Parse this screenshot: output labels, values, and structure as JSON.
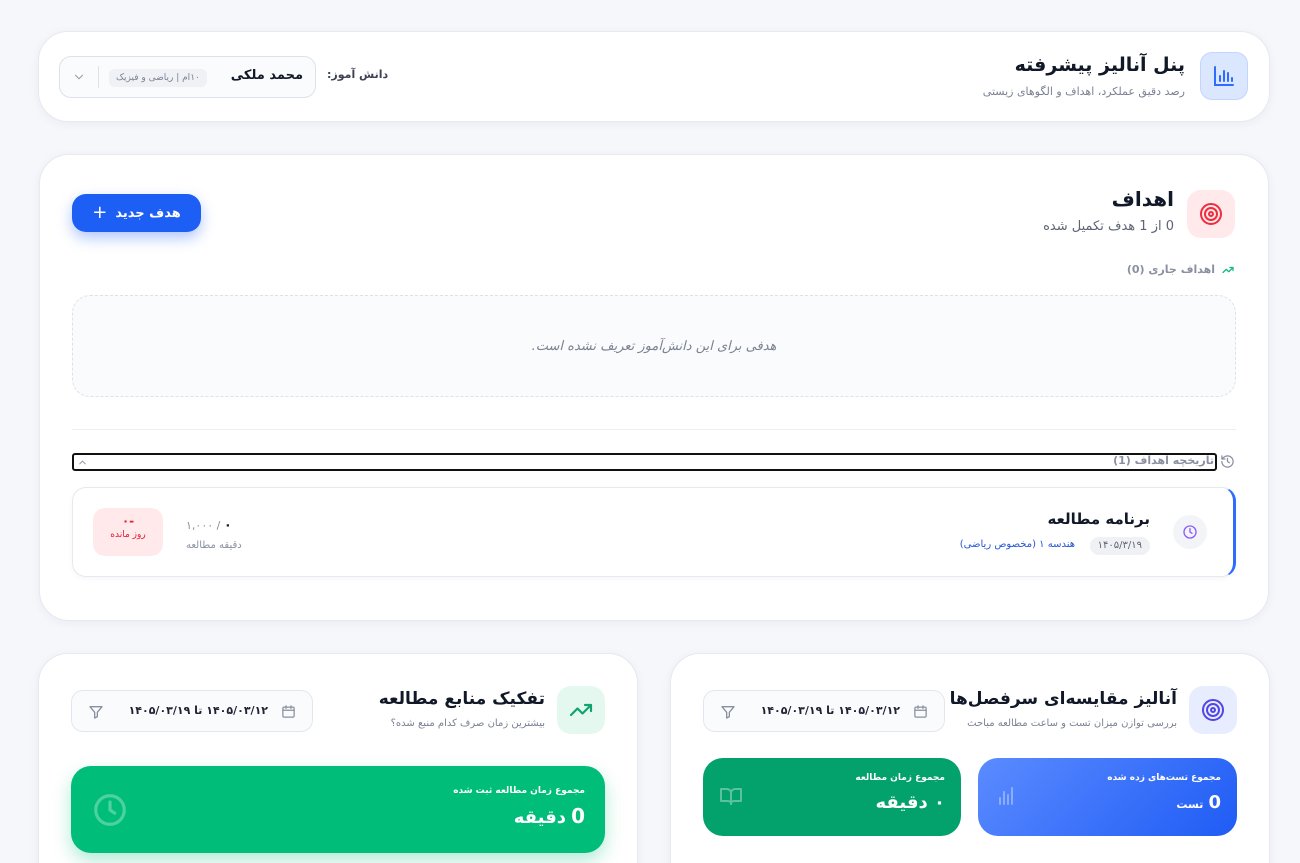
{
  "header": {
    "title": "پنل آنالیز پیشرفته",
    "subtitle": "رصد دقیق عملکرد، اهداف و الگوهای زیستی",
    "student_label": "دانش آموز:",
    "student_name": "محمد ملکی",
    "student_tag": "۱۰ام | ریاضی و فیزیک"
  },
  "goals": {
    "title": "اهداف",
    "summary": "0 از 1 هدف تکمیل شده",
    "new_goal_button": "هدف جدید",
    "active_label": "اهداف جاری (0)",
    "empty_message": "هدفی برای این دانش‌آموز تعریف نشده است.",
    "history_label": "تاریخچه اهداف (1)",
    "history_items": [
      {
        "title": "برنامه مطالعه",
        "date": "۱۴۰۵/۳/۱۹",
        "subject": "هندسه ۱ (مخصوص ریاضی)",
        "progress_done": "۰",
        "progress_target": "/ ۱,۰۰۰",
        "unit": "دقیقه مطالعه",
        "days_left": "-۰",
        "days_left_label": "روز مانده"
      }
    ]
  },
  "compare": {
    "title": "آنالیز مقایسه‌ای سرفصل‌ها",
    "subtitle": "بررسی توازن میزان تست و ساعت مطالعه مباحث",
    "date_range": "۱۴۰۵/۰۳/۱۲ تا ۱۴۰۵/۰۳/۱۹",
    "tests_label": "مجموع تست‌های زده شده",
    "tests_value": "0",
    "tests_unit": "تست",
    "time_label": "مجموع زمان مطالعه",
    "time_value": "۰ دقیقه"
  },
  "sources": {
    "title": "تفکیک منابع مطالعه",
    "subtitle": "بیشترین زمان صرف کدام منبع شده؟",
    "date_range": "۱۴۰۵/۰۳/۱۲ تا ۱۴۰۵/۰۳/۱۹",
    "total_label": "مجموع زمان مطالعه ثبت شده",
    "total_value": "0",
    "total_unit": "دقیقه"
  },
  "icons": {
    "header": "bar-chart-icon",
    "goals": "target-icon",
    "active_goals": "trending-up-icon",
    "history": "history-icon",
    "goal_item": "clock-icon",
    "compare": "target-icon",
    "sources": "trending-up-icon",
    "calendar": "calendar-icon",
    "filter": "filter-icon"
  },
  "colors": {
    "primary": "#1d5ef5",
    "danger": "#e11d2f",
    "success": "#00be7a",
    "success_dark": "#03a16b",
    "accent_purple": "#8b5cf6"
  }
}
